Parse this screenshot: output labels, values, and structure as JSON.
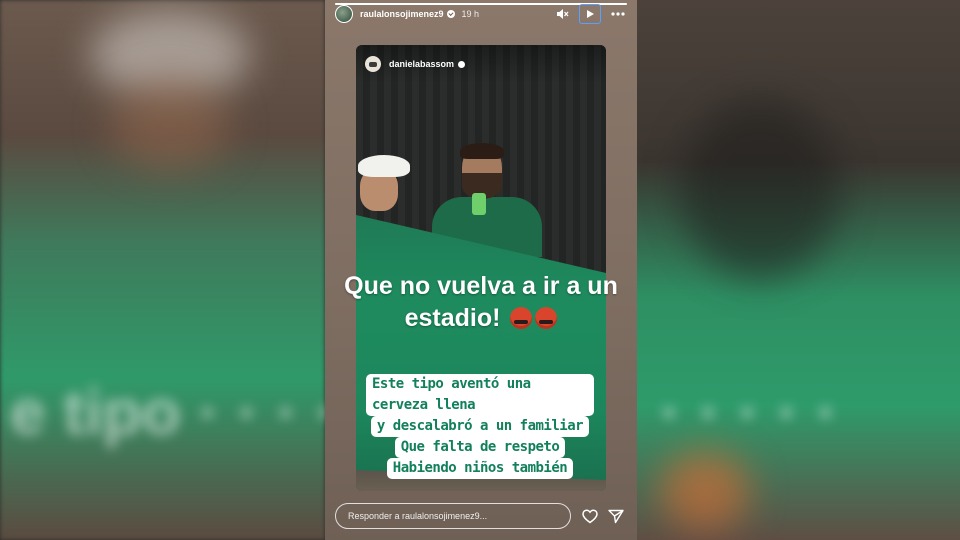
{
  "story": {
    "username": "raulalonsojimenez9",
    "time": "19 h",
    "progress": 1.0,
    "verified_icon": "verified-badge-icon",
    "mute_icon": "speaker-muted-icon",
    "play_icon": "play-icon",
    "more_icon": "more-dots-icon"
  },
  "repost": {
    "username": "danielabassom",
    "overlay_line1": "Que no vuelva a ir a un",
    "overlay_line2": "estadio!",
    "overlay_emojis": [
      "angry-swearing-face-emoji",
      "angry-swearing-face-emoji"
    ],
    "caption_lines": [
      "Este tipo aventó una cerveza llena",
      "y descalabró a un familiar",
      "Que falta de respeto",
      "Habiendo niños también"
    ]
  },
  "reply": {
    "placeholder": "Responder a raulalonsojimenez9...",
    "heart_icon": "heart-icon",
    "send_icon": "send-icon"
  },
  "colors": {
    "accent_focus": "#5aa0ff",
    "caption_text": "#12805a",
    "stadium_green": "#1e8b5e"
  }
}
